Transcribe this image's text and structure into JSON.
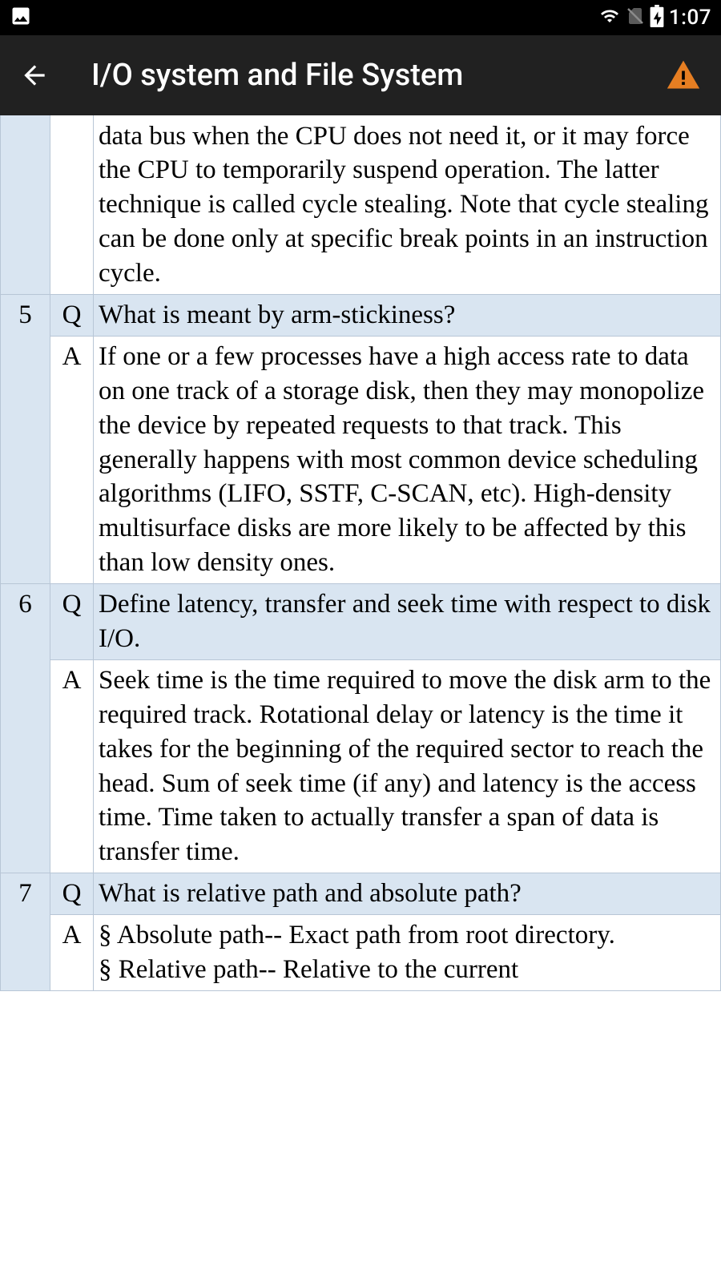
{
  "status": {
    "time": "1:07"
  },
  "header": {
    "title": "I/O system and File System"
  },
  "rows": [
    {
      "num": "",
      "label": "",
      "text": "data bus when the CPU does not need it, or it may force the CPU to temporarily suspend operation. The latter technique is called cycle stealing. Note that cycle stealing can be done only at specific break points in an instruction cycle.",
      "type": "a",
      "partial": true
    },
    {
      "num": "5",
      "label": "Q",
      "text": "What is meant by arm-stickiness?",
      "type": "q"
    },
    {
      "num": "",
      "label": "A",
      "text": "If one or a few processes have a high access rate to data on one track of a storage disk, then they may monopolize the device by repeated requests to that track. This generally happens with most common device scheduling algorithms (LIFO, SSTF, C-SCAN, etc). High-density multisurface disks are more likely to be affected by this than low density ones.",
      "type": "a"
    },
    {
      "num": "6",
      "label": "Q",
      "text": "Define latency, transfer and seek time with respect to disk I/O.",
      "type": "q"
    },
    {
      "num": "",
      "label": "A",
      "text": "Seek time is the time required to move the disk arm to the required track. Rotational delay or latency is the time it takes for the beginning of the required sector to reach the head. Sum of seek time (if any) and latency is the access time. Time taken to actually transfer a span of data is transfer time.",
      "type": "a"
    },
    {
      "num": "7",
      "label": "Q",
      "text": "What is relative path and absolute path?",
      "type": "q"
    },
    {
      "num": "",
      "label": "A",
      "text": "§ Absolute path-- Exact path from root directory.\n§ Relative path-- Relative to the current",
      "type": "a"
    }
  ]
}
